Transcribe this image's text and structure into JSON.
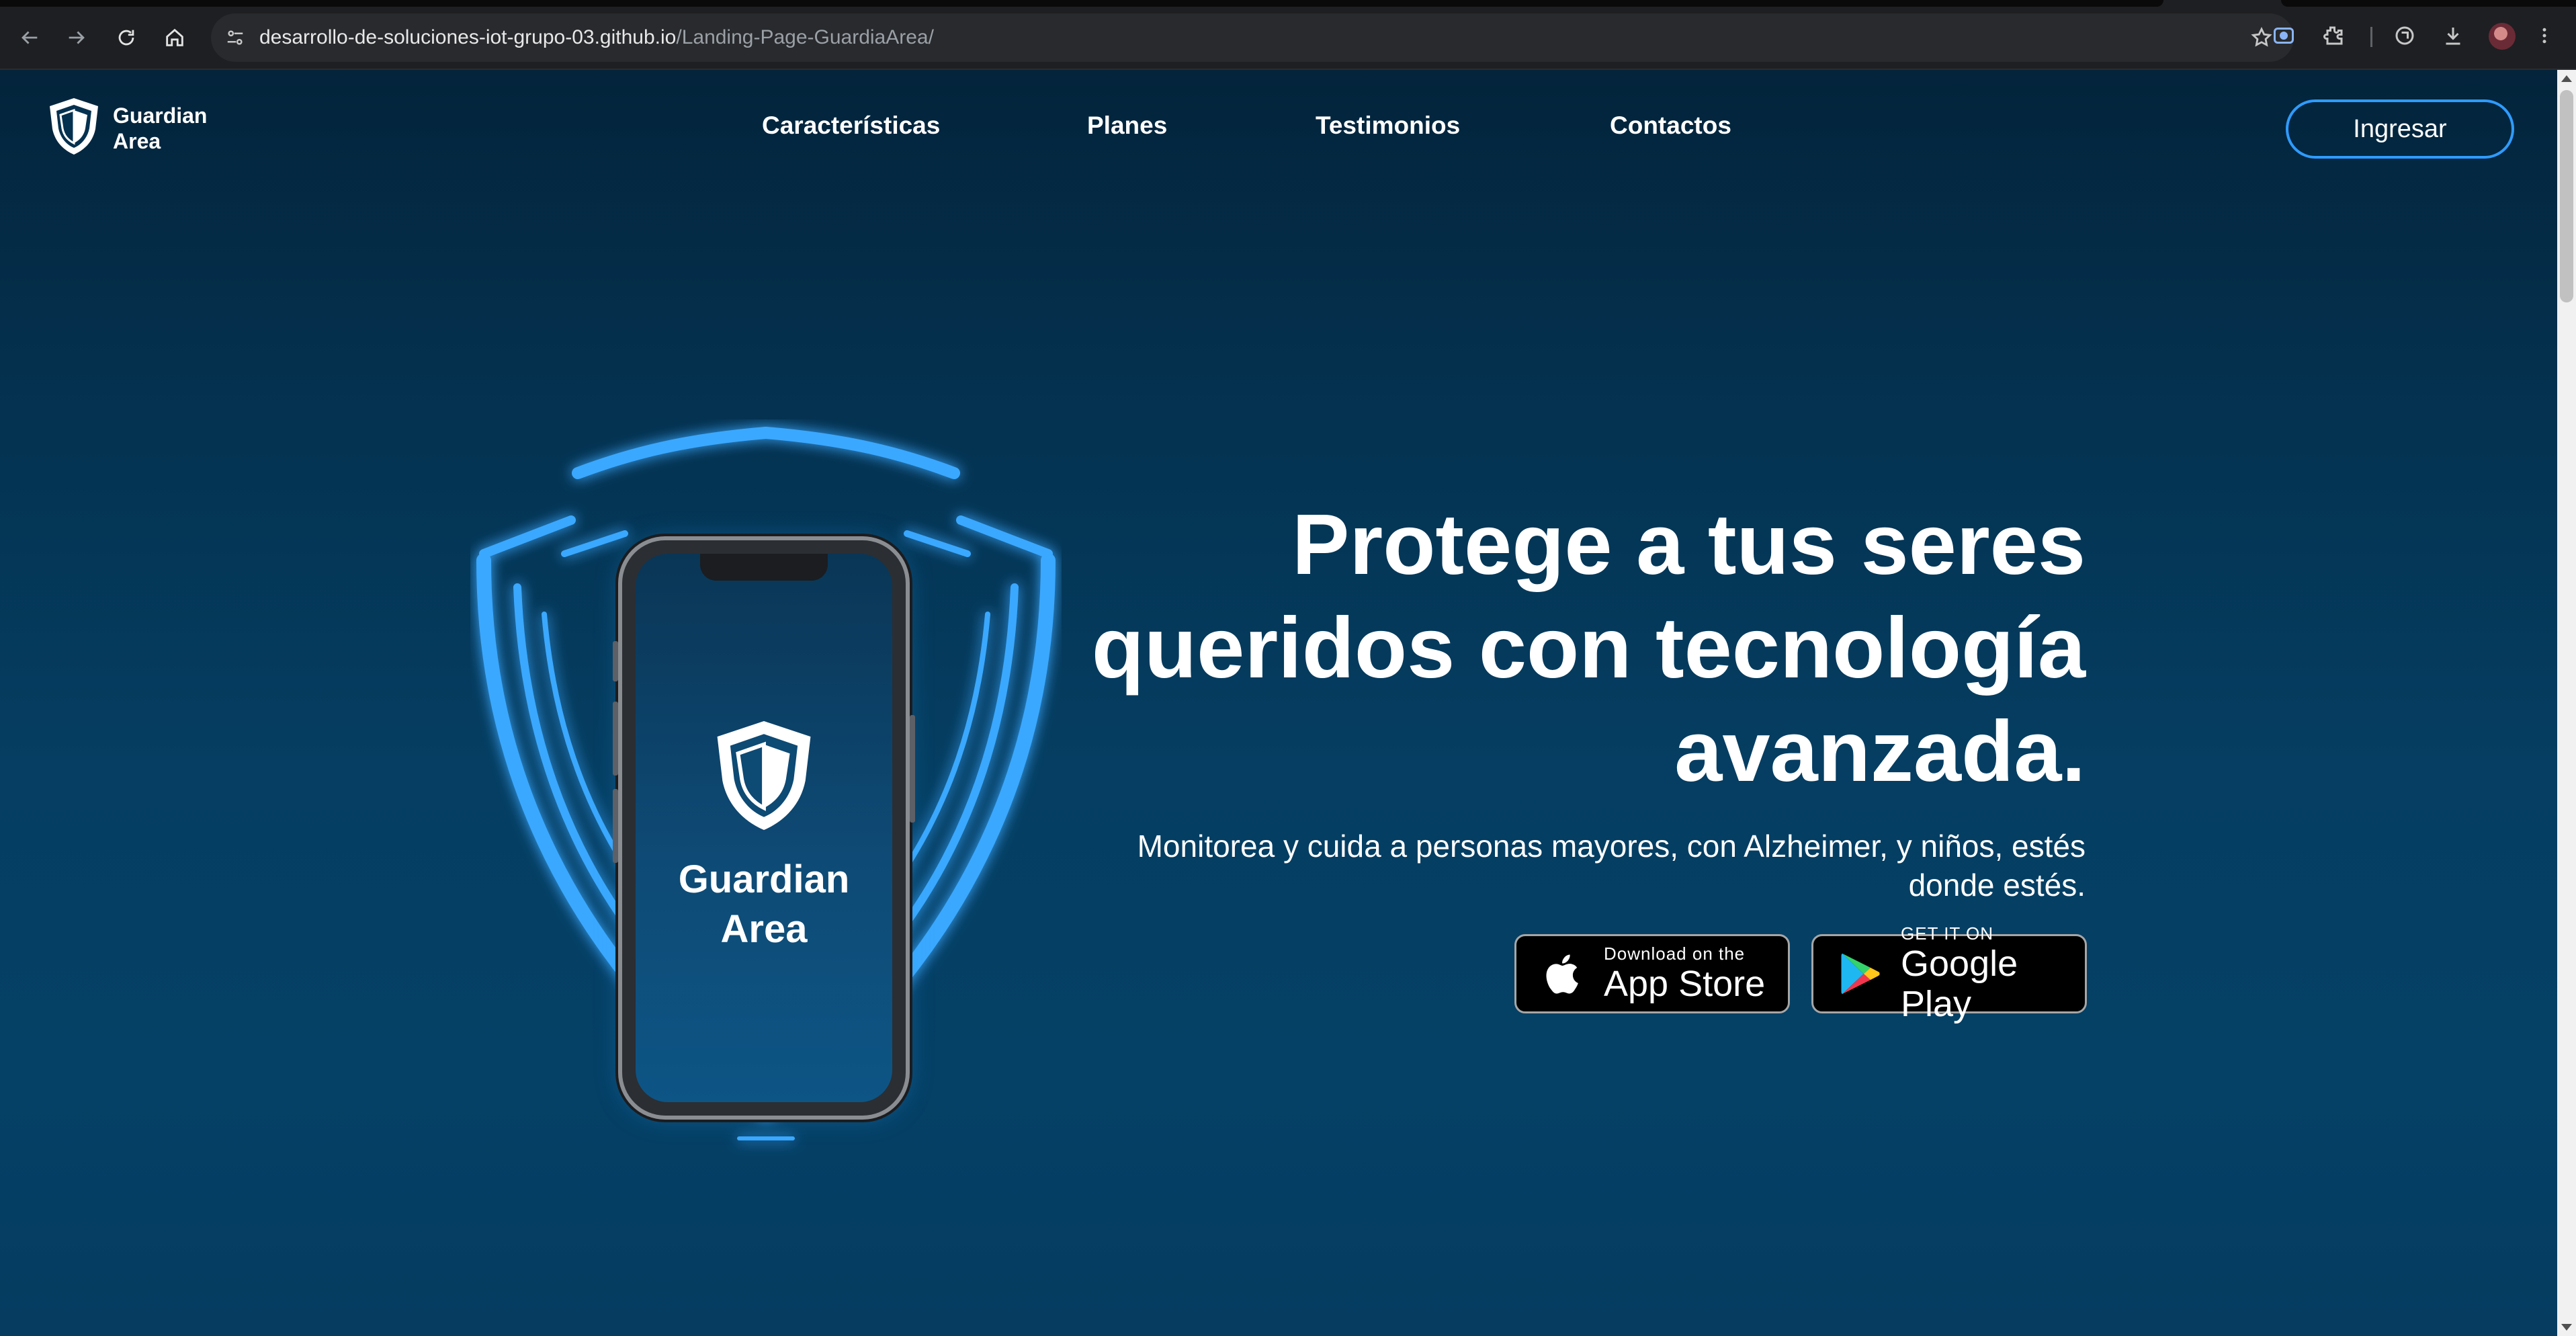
{
  "browser": {
    "url_host": "desarrollo-de-soluciones-iot-grupo-03.github.io",
    "url_path": "/Landing-Page-GuardiaArea/",
    "icons": [
      "back-icon",
      "forward-icon",
      "reload-icon",
      "home-icon",
      "site-info-icon",
      "bookmark-star-icon",
      "screen-capture-icon",
      "extensions-icon",
      "sync-icon",
      "download-icon",
      "profile-avatar",
      "more-menu-icon"
    ]
  },
  "header": {
    "logo_line1": "Guardian",
    "logo_line2": "Area",
    "nav": [
      "Características",
      "Planes",
      "Testimonios",
      "Contactos"
    ],
    "login_label": "Ingresar"
  },
  "hero": {
    "phone_brand_line1": "Guardian",
    "phone_brand_line2": "Area",
    "title_line1": "Protege a tus seres",
    "title_line2": "queridos con tecnología",
    "title_line3": "avanzada.",
    "subtitle_line1": "Monitorea y cuida a personas mayores, con Alzheimer, y niños, estés",
    "subtitle_line2": "donde estés.",
    "app_store": {
      "small": "Download on the",
      "big": "App Store"
    },
    "google_play": {
      "small": "GET IT ON",
      "big": "Google Play"
    }
  },
  "colors": {
    "accent_button_border": "#2f9bff",
    "glow": "#3aa8ff",
    "page_bg_top": "#03243b",
    "page_bg_bottom": "#054066"
  }
}
